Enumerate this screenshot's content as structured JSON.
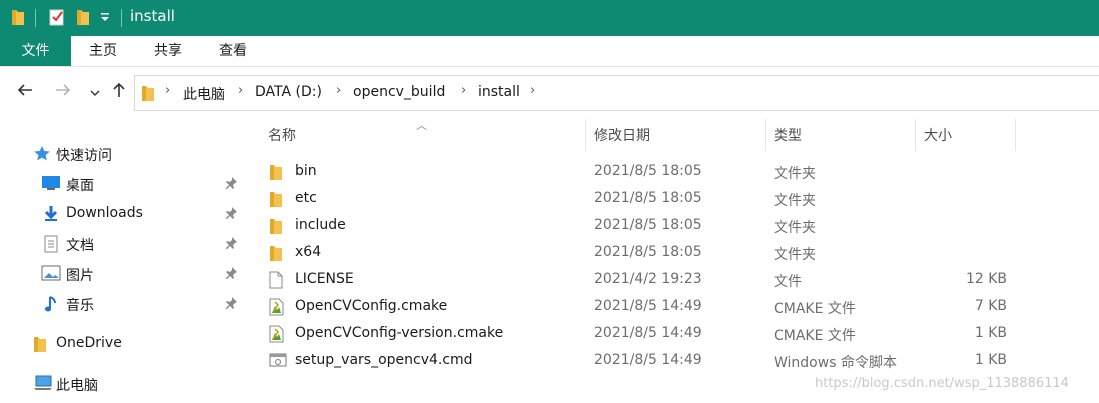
{
  "window": {
    "title": "install"
  },
  "ribbon": {
    "tabs": [
      "文件",
      "主页",
      "共享",
      "查看"
    ]
  },
  "address": {
    "crumbs": [
      "此电脑",
      "DATA (D:)",
      "opencv_build",
      "install"
    ]
  },
  "nav": {
    "items": [
      {
        "label": "快速访问",
        "icon": "star-icon",
        "pinned": false
      },
      {
        "label": "桌面",
        "icon": "desktop-icon",
        "pinned": true
      },
      {
        "label": "Downloads",
        "icon": "download-arrow-icon",
        "pinned": true
      },
      {
        "label": "文档",
        "icon": "document-icon",
        "pinned": true
      },
      {
        "label": "图片",
        "icon": "picture-icon",
        "pinned": true
      },
      {
        "label": "音乐",
        "icon": "music-note-icon",
        "pinned": true
      },
      {
        "label": "OneDrive",
        "icon": "folder-icon",
        "pinned": false
      },
      {
        "label": "此电脑",
        "icon": "computer-icon",
        "pinned": false
      }
    ]
  },
  "columns": {
    "name": "名称",
    "modified": "修改日期",
    "type": "类型",
    "size": "大小"
  },
  "files": [
    {
      "name": "bin",
      "modified": "2021/8/5 18:05",
      "type": "文件夹",
      "size": "",
      "icon": "folder-icon"
    },
    {
      "name": "etc",
      "modified": "2021/8/5 18:05",
      "type": "文件夹",
      "size": "",
      "icon": "folder-icon"
    },
    {
      "name": "include",
      "modified": "2021/8/5 18:05",
      "type": "文件夹",
      "size": "",
      "icon": "folder-icon"
    },
    {
      "name": "x64",
      "modified": "2021/8/5 18:05",
      "type": "文件夹",
      "size": "",
      "icon": "folder-icon"
    },
    {
      "name": "LICENSE",
      "modified": "2021/4/2 19:23",
      "type": "文件",
      "size": "12 KB",
      "icon": "blank-file-icon"
    },
    {
      "name": "OpenCVConfig.cmake",
      "modified": "2021/8/5 14:49",
      "type": "CMAKE 文件",
      "size": "7 KB",
      "icon": "cmake-file-icon"
    },
    {
      "name": "OpenCVConfig-version.cmake",
      "modified": "2021/8/5 14:49",
      "type": "CMAKE 文件",
      "size": "1 KB",
      "icon": "cmake-file-icon"
    },
    {
      "name": "setup_vars_opencv4.cmd",
      "modified": "2021/8/5 14:49",
      "type": "Windows 命令脚本",
      "size": "1 KB",
      "icon": "cmd-file-icon"
    }
  ],
  "watermark": "https://blog.csdn.net/wsp_1138886114",
  "colors": {
    "accent": "#0f8a72",
    "folder": "#f2c14e"
  }
}
